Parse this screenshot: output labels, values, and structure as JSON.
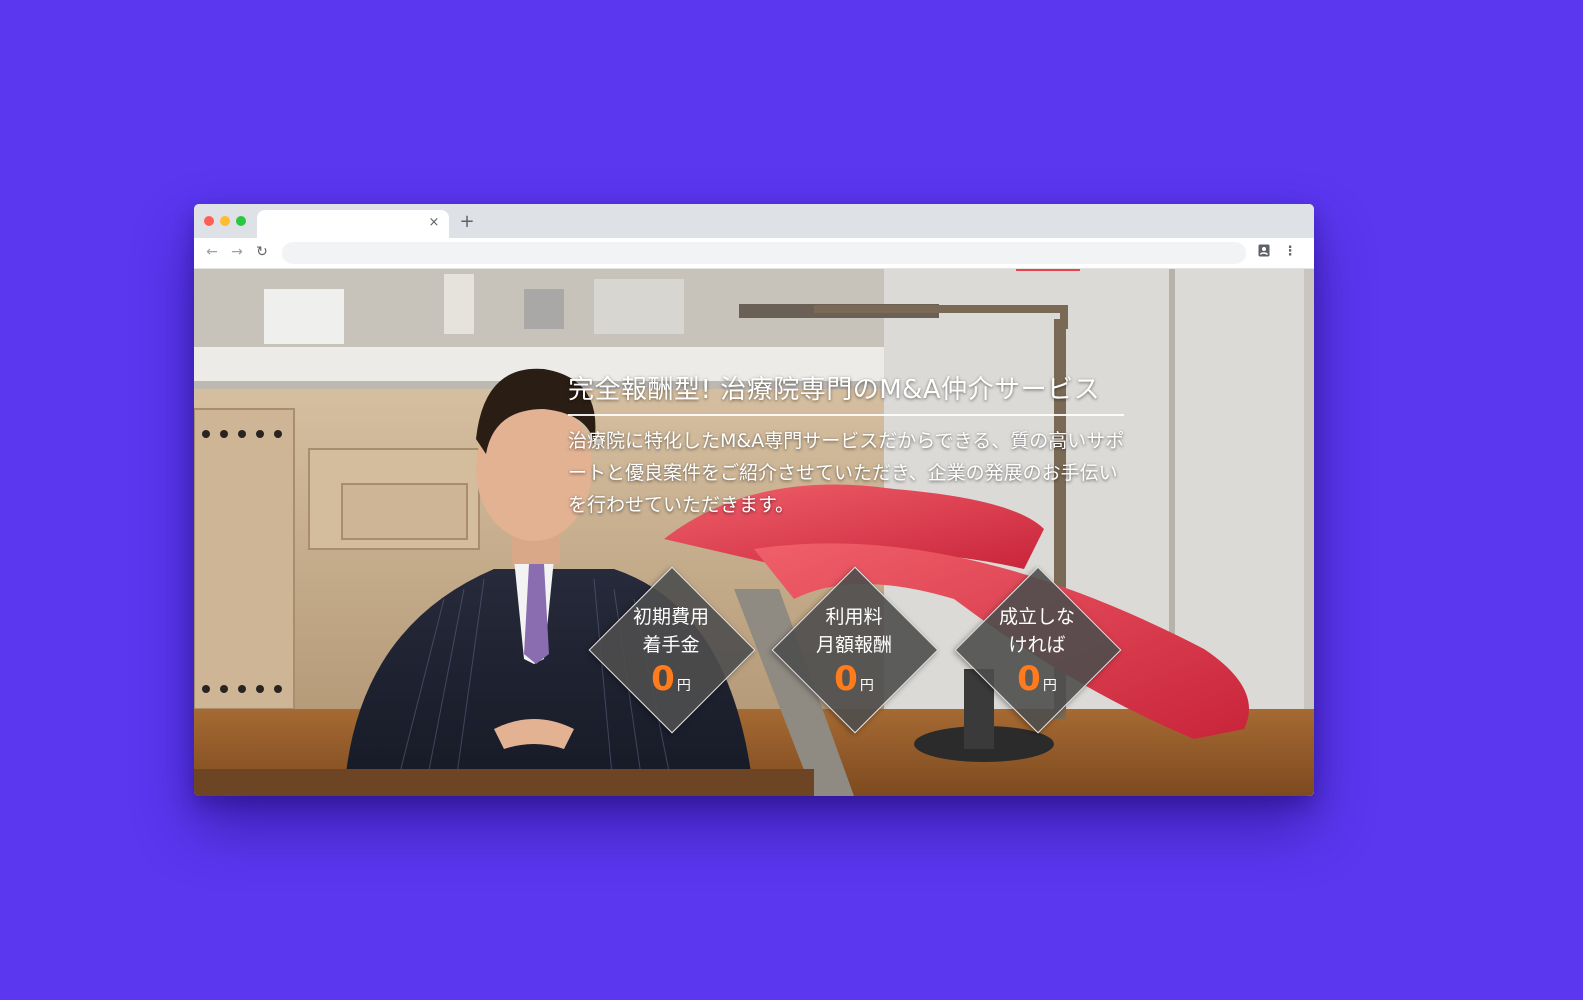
{
  "browser": {
    "traffic_lights": [
      "#ff5f57",
      "#febc2e",
      "#28c840"
    ],
    "tab_close": "×",
    "new_tab": "+",
    "back_icon": "←",
    "forward_icon": "→",
    "reload_icon": "↻",
    "profile_icon": "contact-card-icon",
    "menu_icon": "⋮",
    "address": ""
  },
  "hero": {
    "title": "完全報酬型! 治療院専門のM&A仲介サービス",
    "description": "治療院に特化したM&A専門サービスだからできる、質の高いサポートと優良案件をご紹介させていただき、企業の発展のお手伝いを行わせていただきます。",
    "accent_color": "#ff7b1c"
  },
  "badges": [
    {
      "line1": "初期費用",
      "line2": "着手金",
      "amount": "0",
      "unit": "円"
    },
    {
      "line1": "利用料",
      "line2": "月額報酬",
      "amount": "0",
      "unit": "円"
    },
    {
      "line1": "成立しな",
      "line2": "ければ",
      "amount": "0",
      "unit": "円"
    }
  ]
}
